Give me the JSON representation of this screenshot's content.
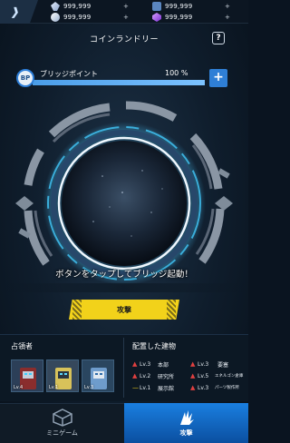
{
  "resources": [
    {
      "icon": "crystal-icon",
      "value": "999,999",
      "plus": "+"
    },
    {
      "icon": "gem-icon",
      "value": "999,999",
      "plus": "+"
    },
    {
      "icon": "gear-chip-icon",
      "value": "999,999",
      "plus": "+"
    },
    {
      "icon": "energy-icon",
      "value": "999,999",
      "plus": "+"
    }
  ],
  "header": {
    "title": "コインランドリー",
    "help": "?"
  },
  "bridge": {
    "badge": "BP",
    "label": "ブリッジポイント",
    "percent_text": "100 %",
    "progress": 1.0,
    "add": "+"
  },
  "message": "ボタンをタップしてブリッジ起動！",
  "attack": {
    "label": "攻撃"
  },
  "occupants": {
    "title": "占領者",
    "cards": [
      {
        "lv": "Lv.4",
        "color": "#7a2a2a"
      },
      {
        "lv": "Lv.1",
        "color": "#c4b050"
      },
      {
        "lv": "Lv.3",
        "color": "#4f7fb0"
      }
    ]
  },
  "buildings": {
    "title": "配置した建物",
    "rows": [
      {
        "dir": "up",
        "lv": "Lv.3",
        "name": "本部"
      },
      {
        "dir": "up",
        "lv": "Lv.3",
        "name": "要塞"
      },
      {
        "dir": "up",
        "lv": "Lv.2",
        "name": "研究所"
      },
      {
        "dir": "up",
        "lv": "Lv.5",
        "name": "エネルゴン倉庫"
      },
      {
        "dir": "flat",
        "lv": "Lv.1",
        "name": "展示館"
      },
      {
        "dir": "up",
        "lv": "Lv.3",
        "name": "パーツ製作所"
      }
    ]
  },
  "nav": {
    "minigame": "ミニゲーム",
    "attack": "攻撃"
  },
  "colors": {
    "accent": "#2f7fd6",
    "attack_yellow": "#f2d21a",
    "up_arrow": "#e04040",
    "flat": "#f2d21a"
  }
}
